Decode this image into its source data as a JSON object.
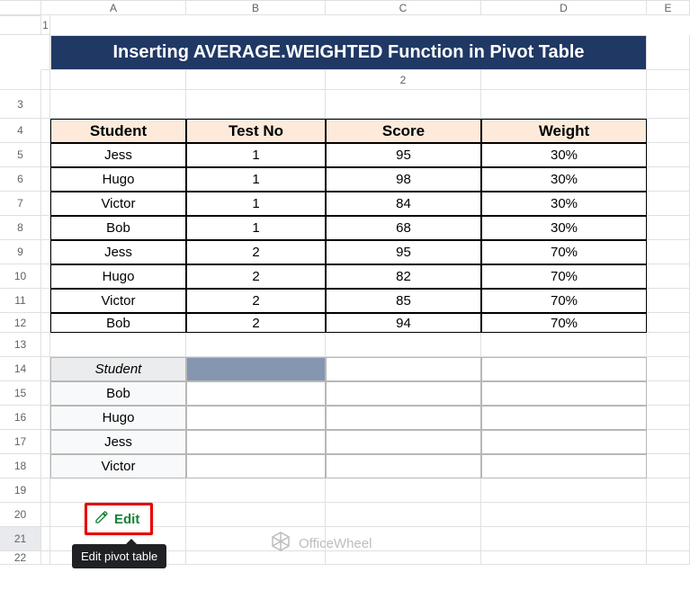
{
  "columns": [
    "A",
    "B",
    "C",
    "D",
    "E"
  ],
  "rows": [
    "1",
    "2",
    "3",
    "4",
    "5",
    "6",
    "7",
    "8",
    "9",
    "10",
    "11",
    "12",
    "13",
    "14",
    "15",
    "16",
    "17",
    "18",
    "19",
    "20",
    "21",
    "22"
  ],
  "title": "Inserting AVERAGE.WEIGHTED Function in Pivot Table",
  "headers": {
    "student": "Student",
    "testno": "Test No",
    "score": "Score",
    "weight": "Weight"
  },
  "data": [
    {
      "student": "Jess",
      "testno": "1",
      "score": "95",
      "weight": "30%"
    },
    {
      "student": "Hugo",
      "testno": "1",
      "score": "98",
      "weight": "30%"
    },
    {
      "student": "Victor",
      "testno": "1",
      "score": "84",
      "weight": "30%"
    },
    {
      "student": "Bob",
      "testno": "1",
      "score": "68",
      "weight": "30%"
    },
    {
      "student": "Jess",
      "testno": "2",
      "score": "95",
      "weight": "70%"
    },
    {
      "student": "Hugo",
      "testno": "2",
      "score": "82",
      "weight": "70%"
    },
    {
      "student": "Victor",
      "testno": "2",
      "score": "85",
      "weight": "70%"
    },
    {
      "student": "Bob",
      "testno": "2",
      "score": "94",
      "weight": "70%"
    }
  ],
  "pivot": {
    "header": "Student",
    "rows": [
      "Bob",
      "Hugo",
      "Jess",
      "Victor"
    ]
  },
  "edit": {
    "label": "Edit",
    "tooltip": "Edit pivot table"
  },
  "watermark": "OfficeWheel",
  "chart_data": {
    "type": "table",
    "title": "Inserting AVERAGE.WEIGHTED Function in Pivot Table",
    "columns": [
      "Student",
      "Test No",
      "Score",
      "Weight"
    ],
    "rows": [
      [
        "Jess",
        1,
        95,
        0.3
      ],
      [
        "Hugo",
        1,
        98,
        0.3
      ],
      [
        "Victor",
        1,
        84,
        0.3
      ],
      [
        "Bob",
        1,
        68,
        0.3
      ],
      [
        "Jess",
        2,
        95,
        0.7
      ],
      [
        "Hugo",
        2,
        82,
        0.7
      ],
      [
        "Victor",
        2,
        85,
        0.7
      ],
      [
        "Bob",
        2,
        94,
        0.7
      ]
    ]
  }
}
